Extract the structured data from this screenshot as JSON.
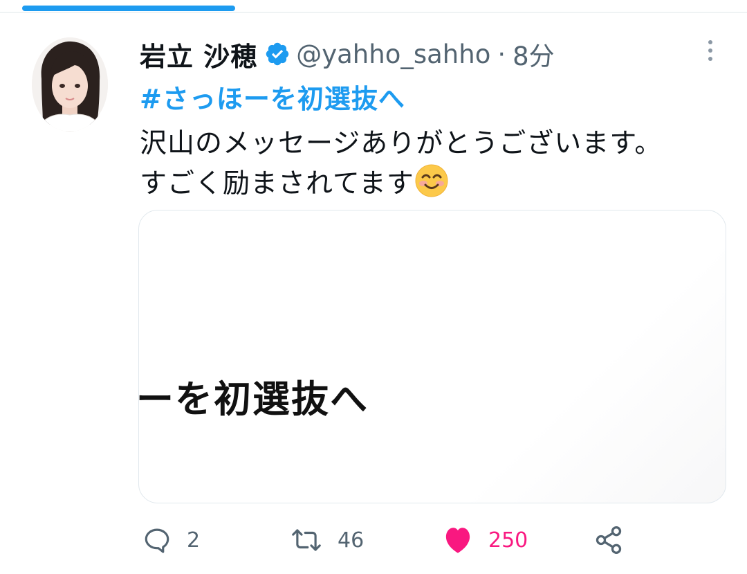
{
  "tweet": {
    "author": {
      "display_name": "岩立 沙穂",
      "handle": "@yahho_sahho",
      "separator": "·",
      "time": "8分"
    },
    "hashtag": "#さっほーを初選抜へ",
    "text_line1": "沢山のメッセージありがとうございます。",
    "text_line2": "すごく励まされてます",
    "media": {
      "visible_text": "ーを初選抜へ"
    }
  },
  "actions": {
    "replies": "2",
    "retweets": "46",
    "likes": "250"
  },
  "icons": {
    "verified": "verified-badge-icon",
    "more": "more-vertical-icon",
    "reply": "reply-icon",
    "retweet": "retweet-icon",
    "like": "heart-icon",
    "share": "share-icon",
    "emoji": "smiling-face-emoji"
  },
  "colors": {
    "accent": "#1d9bf0",
    "like": "#f91880",
    "secondary_text": "#536471",
    "primary_text": "#0f1419"
  },
  "progress": 0.3
}
